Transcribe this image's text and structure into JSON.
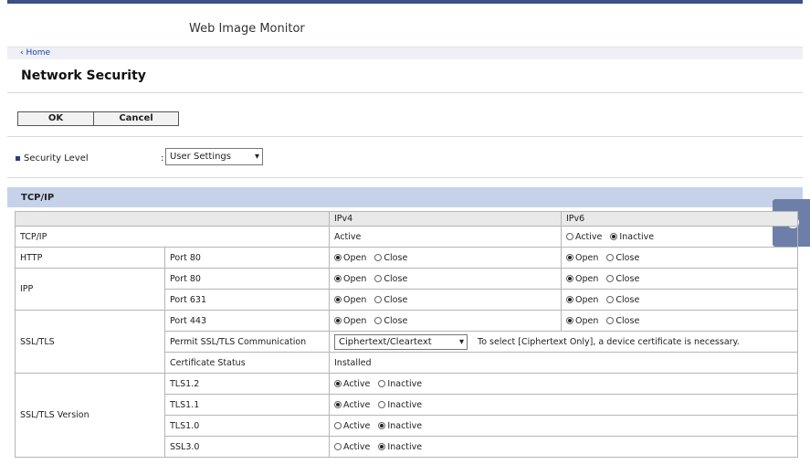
{
  "app": {
    "title": "Web Image Monitor"
  },
  "nav": {
    "home_link": "‹ Home"
  },
  "page": {
    "title": "Network Security"
  },
  "buttons": {
    "ok": "OK",
    "cancel": "Cancel"
  },
  "security_level": {
    "label": "Security Level",
    "colon": ":",
    "value": "User Settings"
  },
  "section": {
    "title": "TCP/IP"
  },
  "table": {
    "col_ipv4": "IPv4",
    "col_ipv6": "IPv6",
    "tcpip": {
      "label": "TCP/IP",
      "ipv4": "Active",
      "ipv6_active": "Active",
      "ipv6_inactive": "Inactive",
      "ipv6_selected": "Inactive"
    },
    "http": {
      "label": "HTTP",
      "port": "Port 80",
      "ipv4_selected": "Open",
      "ipv6_selected": "Open"
    },
    "ipp": {
      "label": "IPP",
      "rows": [
        {
          "port": "Port 80",
          "ipv4_selected": "Open",
          "ipv6_selected": "Open"
        },
        {
          "port": "Port 631",
          "ipv4_selected": "Open",
          "ipv6_selected": "Open"
        }
      ]
    },
    "ssl": {
      "label": "SSL/TLS",
      "port": "Port 443",
      "permit_label": "Permit SSL/TLS Communication",
      "permit_value": "Ciphertext/Cleartext",
      "permit_note": "To select [Ciphertext Only], a device certificate is necessary.",
      "cert_label": "Certificate Status",
      "cert_value": "Installed"
    },
    "ssl_version": {
      "label": "SSL/TLS Version",
      "rows": [
        {
          "name": "TLS1.2",
          "selected": "Active"
        },
        {
          "name": "TLS1.1",
          "selected": "Active"
        },
        {
          "name": "TLS1.0",
          "selected": "Inactive"
        },
        {
          "name": "SSL3.0",
          "selected": "Inactive"
        }
      ]
    },
    "options": {
      "open": "Open",
      "close": "Close",
      "active": "Active",
      "inactive": "Inactive"
    }
  },
  "side_tab": {
    "icon": "help-circle-icon"
  }
}
